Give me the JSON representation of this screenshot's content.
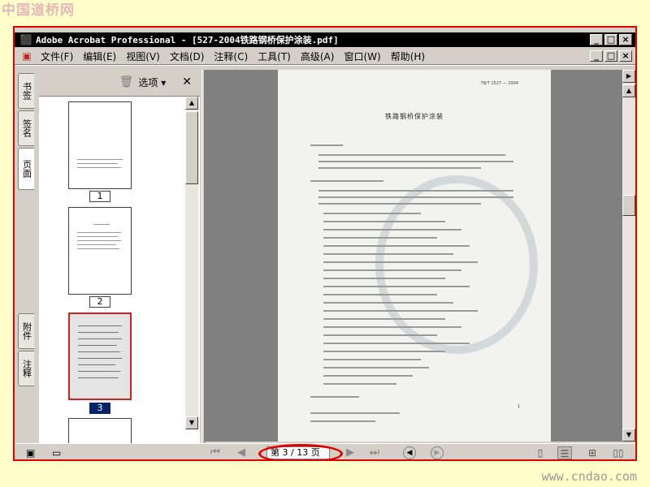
{
  "watermarks": {
    "top": "中国道桥网",
    "bottom": "www.cndao.com"
  },
  "window": {
    "title": "Adobe Acrobat Professional - [527-2004铁路钢桥保护涂装.pdf]",
    "minimize": "_",
    "restore": "□",
    "close": "×"
  },
  "menu": {
    "items": [
      "文件(F)",
      "编辑(E)",
      "视图(V)",
      "文档(D)",
      "注释(C)",
      "工具(T)",
      "高级(A)",
      "窗口(W)",
      "帮助(H)"
    ]
  },
  "nav_tabs": [
    "书签",
    "签名",
    "页面",
    "附件",
    "注释"
  ],
  "pages_panel": {
    "options_label": "选项",
    "thumbnails": [
      "1",
      "2",
      "3"
    ],
    "selected_index": 2
  },
  "document": {
    "header_code": "TB/T 1527 — 2004",
    "title": "铁路钢桥保护涂装",
    "page_number": "1"
  },
  "navigation": {
    "page_display": "第 3 / 13 页",
    "current_page": 3,
    "total_pages": 13
  },
  "icons": {
    "app": "adobe-acrobat-icon",
    "trash": "trash-icon",
    "first_page": "first-page-icon",
    "prev_page": "prev-page-icon",
    "next_page": "next-page-icon",
    "last_page": "last-page-icon"
  },
  "colors": {
    "annotation": "#e00000",
    "selection": "#0a246a",
    "background": "#fffdc8"
  }
}
